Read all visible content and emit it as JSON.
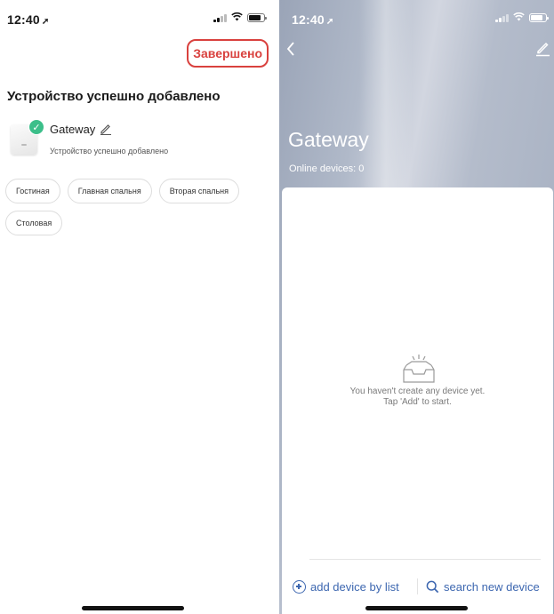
{
  "left": {
    "status": {
      "time": "12:40"
    },
    "done_button": "Завершено",
    "success_title": "Устройство успешно добавлено",
    "device": {
      "name": "Gateway",
      "subtitle": "Устройство успешно добавлено"
    },
    "rooms": [
      "Гостиная",
      "Главная спальня",
      "Вторая спальня",
      "Столовая"
    ]
  },
  "right": {
    "status": {
      "time": "12:40"
    },
    "title": "Gateway",
    "online_devices": "Online devices: 0",
    "empty_line1": "You haven't create any device yet.",
    "empty_line2": "Tap 'Add' to start.",
    "add_by_list": "add device by list",
    "search_new": "search new device"
  },
  "colors": {
    "done_accent": "#d9413e",
    "success_check": "#3cbf8a",
    "link_blue": "#3d67b0"
  },
  "icons": [
    "location-arrow-icon",
    "signal-icon",
    "wifi-icon",
    "battery-icon",
    "check-icon",
    "pencil-icon",
    "back-chevron-icon",
    "edit-icon",
    "empty-inbox-icon",
    "plus-circle-icon",
    "search-icon"
  ]
}
